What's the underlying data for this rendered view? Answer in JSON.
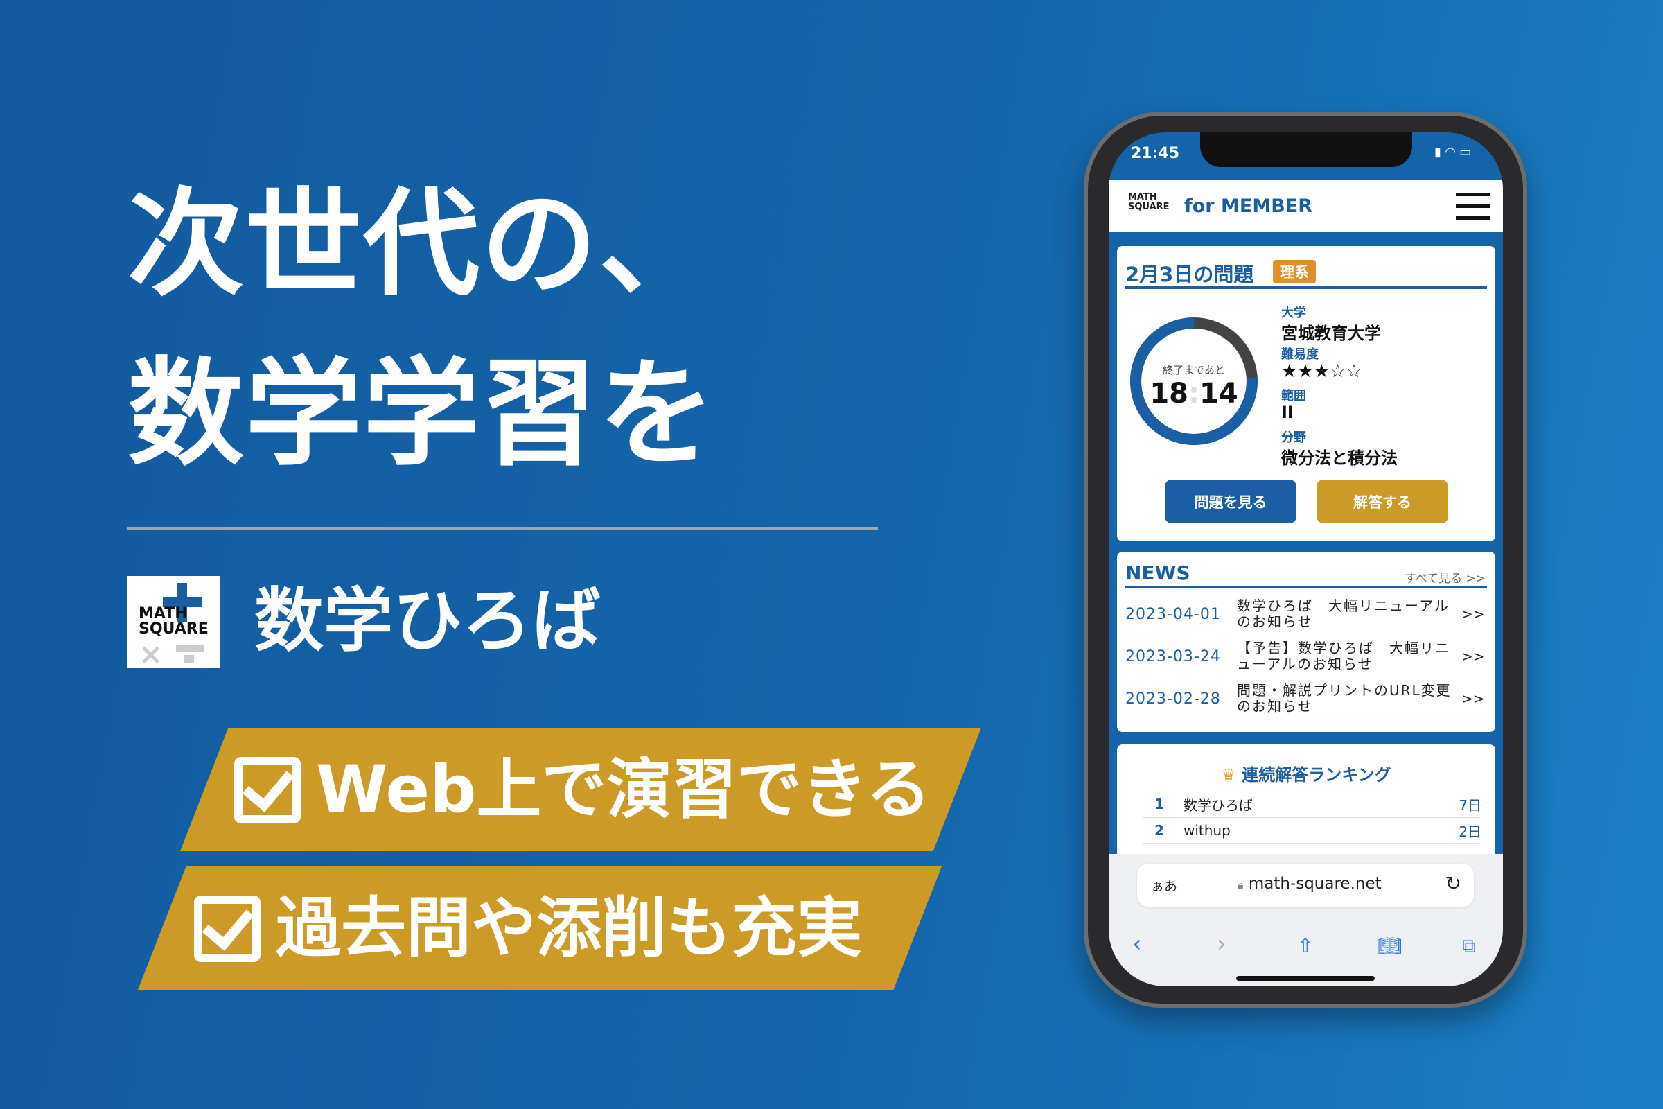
{
  "hero": {
    "line1": "次世代の、",
    "line2": "数学学習を"
  },
  "brand": {
    "logo_text_1": "MATH",
    "logo_text_2": "SQUARE",
    "name": "数学ひろば"
  },
  "features": [
    "Web上で演習できる",
    "過去問や添削も充実"
  ],
  "colors": {
    "background": "#1560a5",
    "gold": "#cc9a26",
    "blue": "#1a5fa3",
    "orange_tag": "#e0902a"
  },
  "phone": {
    "status": {
      "time": "21:45"
    },
    "header": {
      "title": "for MEMBER",
      "menu_icon": "hamburger-icon"
    },
    "problem": {
      "title": "2月3日の問題",
      "tag": "理系",
      "timer_label": "終了まであと",
      "timer_minutes": "18",
      "timer_seconds": "14",
      "timer_fraction_remaining": 0.76,
      "university_label": "大学",
      "university": "宮城教育大学",
      "difficulty_label": "難易度",
      "difficulty_stars": "★★★☆☆",
      "difficulty": 3,
      "range_label": "範囲",
      "range": "II",
      "field_label": "分野",
      "field": "微分法と積分法",
      "view_button": "問題を見る",
      "answer_button": "解答する"
    },
    "news": {
      "title": "NEWS",
      "see_all": "すべて見る >>",
      "items": [
        {
          "date": "2023-04-01",
          "title": "数学ひろば　大幅リニューアルのお知らせ",
          "arrow": ">>"
        },
        {
          "date": "2023-03-24",
          "title": "【予告】数学ひろば　大幅リニューアルのお知らせ",
          "arrow": ">>"
        },
        {
          "date": "2023-02-28",
          "title": "問題・解説プリントのURL変更のお知らせ",
          "arrow": ">>"
        }
      ]
    },
    "ranking": {
      "title": "連続解答ランキング",
      "rows": [
        {
          "rank": "1",
          "name": "数学ひろば",
          "days": "7日"
        },
        {
          "rank": "2",
          "name": "withup",
          "days": "2日"
        }
      ]
    },
    "browser": {
      "text_size": "ぁあ",
      "url": "math-square.net"
    }
  }
}
